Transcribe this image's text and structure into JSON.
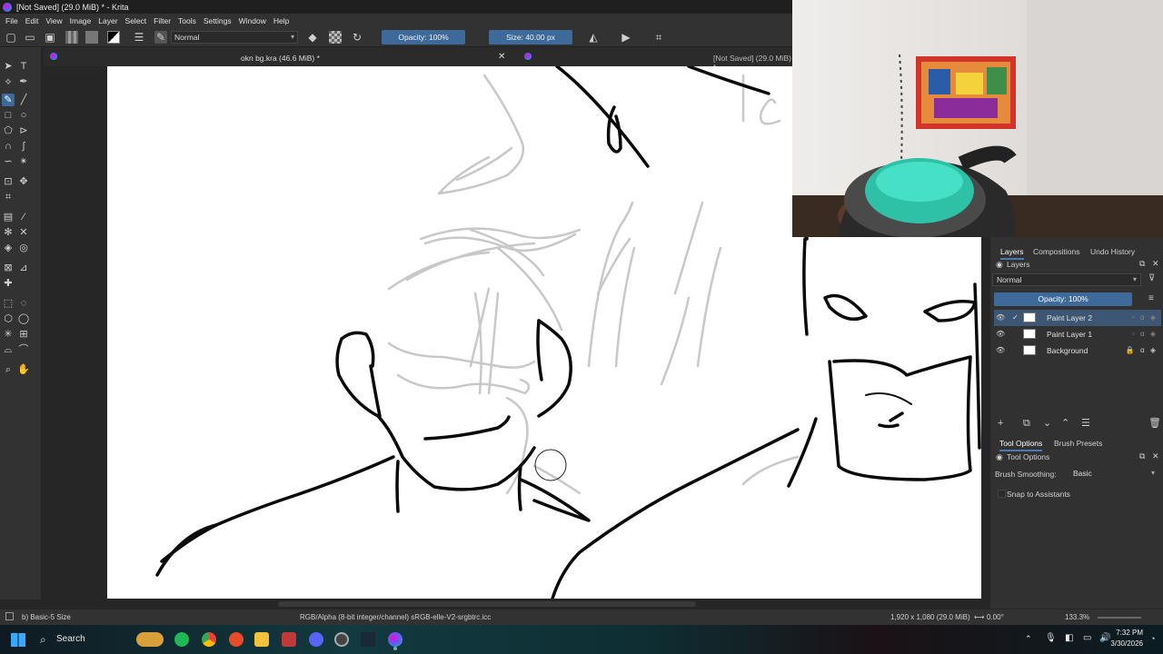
{
  "window": {
    "title": "[Not Saved]  (29.0 MiB) * - Krita"
  },
  "menu": {
    "items": [
      "File",
      "Edit",
      "View",
      "Image",
      "Layer",
      "Select",
      "Filter",
      "Tools",
      "Settings",
      "Window",
      "Help"
    ]
  },
  "toolbar": {
    "blend_mode": "Normal",
    "opacity_label": "Opacity: 100%",
    "size_label": "Size: 40.00 px"
  },
  "tabs": {
    "active_doc": "okn bg.kra (46.6 MiB) *",
    "second_doc": "[Not Saved]  (29.0 MiB) *",
    "close_glyph": "✕"
  },
  "docker": {
    "tabs": [
      "Layers",
      "Compositions",
      "Undo History"
    ],
    "layers_title": "Layers",
    "blend_mode": "Normal",
    "opacity_label": "Opacity:  100%",
    "layers": [
      {
        "name": "Paint Layer 2",
        "selected": true
      },
      {
        "name": "Paint Layer 1",
        "selected": false
      },
      {
        "name": "Background",
        "selected": false
      }
    ],
    "bottom_tabs": [
      "Tool Options",
      "Brush Presets"
    ],
    "tool_options_title": "Tool Options",
    "brush_smoothing_label": "Brush Smoothing:",
    "brush_smoothing_value": "Basic",
    "snap_label": "Snap to Assistants"
  },
  "status": {
    "brush": "b) Basic-5 Size",
    "color_profile": "RGB/Alpha (8-bit integer/channel)  sRGB-elle-V2-srgbtrc.icc",
    "image_size": "1,920 x 1,080 (29.0 MiB)",
    "rotation": "0.00°",
    "zoom": "133.3%"
  },
  "taskbar": {
    "search_label": "Search",
    "time": "7:32 PM",
    "date": "3/30/2026"
  },
  "colors": {
    "accent": "#3d6a99",
    "selection": "#3d5673",
    "panel": "#323232"
  }
}
